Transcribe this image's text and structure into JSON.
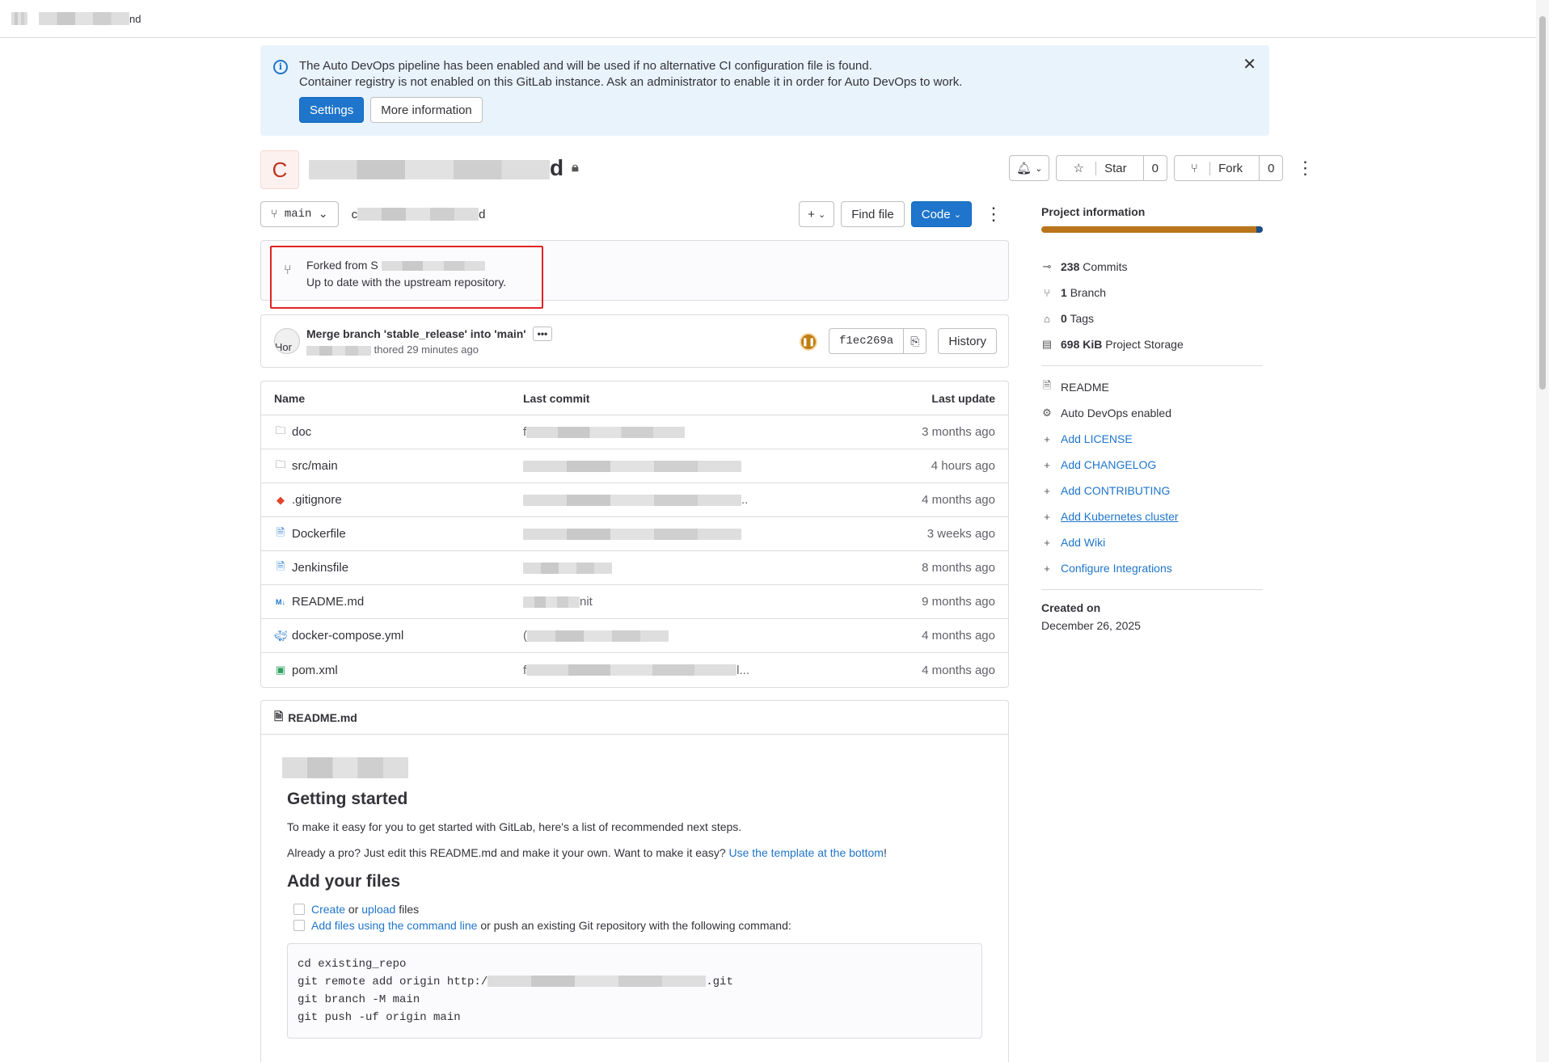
{
  "topbar": {
    "breadcrumb_suffix": "nd"
  },
  "alert": {
    "line1": "The Auto DevOps pipeline has been enabled and will be used if no alternative CI configuration file is found.",
    "line2": "Container registry is not enabled on this GitLab instance. Ask an administrator to enable it in order for Auto DevOps to work.",
    "settings_label": "Settings",
    "more_info_label": "More information"
  },
  "project": {
    "avatar_letter": "C",
    "title_suffix": "d",
    "star_label": "Star",
    "star_count": "0",
    "fork_label": "Fork",
    "fork_count": "0"
  },
  "branch_bar": {
    "branch": "main",
    "path_prefix": "c",
    "path_suffix": "d",
    "find_file": "Find file",
    "code": "Code"
  },
  "fork": {
    "forked_from": "Forked from S",
    "status": "Up to date with the upstream repository."
  },
  "commit": {
    "message": "Merge branch 'stable_release' into 'main'",
    "meta": "thored 29 minutes ago",
    "sha": "f1ec269a",
    "history": "History",
    "avatar_text": "Hor"
  },
  "files": {
    "headers": {
      "name": "Name",
      "last_commit": "Last commit",
      "last_update": "Last update"
    },
    "rows": [
      {
        "name": "doc",
        "type": "folder",
        "commit_prefix": "f",
        "commit_suffix": "",
        "date": "3 months ago"
      },
      {
        "name": "src/main",
        "type": "folder",
        "commit_prefix": "",
        "commit_suffix": "",
        "date": "4 hours ago"
      },
      {
        "name": ".gitignore",
        "type": "git",
        "commit_prefix": "",
        "commit_suffix": "..",
        "date": "4 months ago"
      },
      {
        "name": "Dockerfile",
        "type": "file",
        "commit_prefix": "",
        "commit_suffix": "",
        "date": "3 weeks ago"
      },
      {
        "name": "Jenkinsfile",
        "type": "file",
        "commit_prefix": "",
        "commit_suffix": "",
        "date": "8 months ago"
      },
      {
        "name": "README.md",
        "type": "md",
        "commit_prefix": "",
        "commit_suffix": "nit",
        "date": "9 months ago"
      },
      {
        "name": "docker-compose.yml",
        "type": "docker",
        "commit_prefix": "(",
        "commit_suffix": "",
        "date": "4 months ago"
      },
      {
        "name": "pom.xml",
        "type": "pom",
        "commit_prefix": "f",
        "commit_suffix": "l...",
        "date": "4 months ago"
      }
    ]
  },
  "readme": {
    "filename": "README.md",
    "h_getting_started": "Getting started",
    "p1": "To make it easy for you to get started with GitLab, here's a list of recommended next steps.",
    "p2_text": "Already a pro? Just edit this README.md and make it your own. Want to make it easy? ",
    "p2_link": "Use the template at the bottom",
    "p2_end": "!",
    "h_add_files": "Add your files",
    "task1_create": "Create",
    "task1_or": " or ",
    "task1_upload": "upload",
    "task1_files": " files",
    "task2_link": "Add files using the command line",
    "task2_rest": " or push an existing Git repository with the following command:",
    "code_line1": "cd existing_repo",
    "code_line2_prefix": "git remote add origin http:/",
    "code_line2_suffix": ".git",
    "code_line3": "git branch -M main",
    "code_line4": "git push -uf origin main"
  },
  "sidebar": {
    "title": "Project information",
    "commits_count": "238",
    "commits_label": "Commits",
    "branch_count": "1",
    "branch_label": "Branch",
    "tags_count": "0",
    "tags_label": "Tags",
    "storage_size": "698 KiB",
    "storage_label": "Project Storage",
    "readme": "README",
    "auto_devops": "Auto DevOps enabled",
    "add_license": "Add LICENSE",
    "add_changelog": "Add CHANGELOG",
    "add_contributing": "Add CONTRIBUTING",
    "add_k8s": "Add Kubernetes cluster",
    "add_wiki": "Add Wiki",
    "configure_integrations": "Configure Integrations",
    "created_label": "Created on",
    "created_date": "December 26, 2025"
  }
}
